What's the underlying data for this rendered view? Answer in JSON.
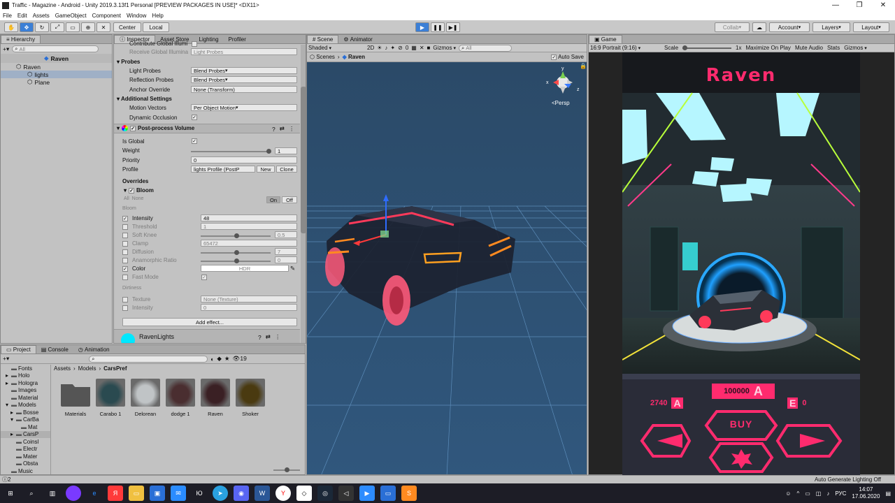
{
  "window": {
    "title": "Traffic - Magazine - Android - Unity 2019.3.13f1 Personal [PREVIEW PACKAGES IN USE]* <DX11>"
  },
  "menu": [
    "File",
    "Edit",
    "Assets",
    "GameObject",
    "Component",
    "Window",
    "Help"
  ],
  "toolbar": {
    "center": "Center",
    "local": "Local",
    "collab": "Collab",
    "account": "Account",
    "layers": "Layers",
    "layout": "Layout"
  },
  "hierarchy": {
    "tab": "Hierarchy",
    "search_placeholder": "All",
    "scene": "Raven",
    "items": [
      "Raven",
      "lights",
      "Plane"
    ]
  },
  "inspector": {
    "tabs": [
      "Inspector",
      "Asset Store",
      "Lighting",
      "Profiler"
    ],
    "rows_top": [
      {
        "label": "Contribute Global Illumi",
        "value": ""
      },
      {
        "label": "Receive Global Illumina",
        "value": "Light Probes"
      }
    ],
    "probes": {
      "header": "Probes",
      "light_probes_label": "Light Probes",
      "light_probes": "Blend Probes",
      "reflection_probes_label": "Reflection Probes",
      "reflection_probes": "Blend Probes",
      "anchor_label": "Anchor Override",
      "anchor": "None (Transform)"
    },
    "additional": {
      "header": "Additional Settings",
      "motion_label": "Motion Vectors",
      "motion": "Per Object Motion",
      "occlusion_label": "Dynamic Occlusion"
    },
    "ppv": {
      "header": "Post-process Volume",
      "is_global": "Is Global",
      "weight_label": "Weight",
      "weight": "1",
      "priority_label": "Priority",
      "priority": "0",
      "profile_label": "Profile",
      "profile": "lights Profile (PostP",
      "new": "New",
      "clone": "Clone"
    },
    "overrides": {
      "header": "Overrides",
      "bloom": "Bloom",
      "all": "All",
      "none": "None",
      "on": "On",
      "off": "Off",
      "bloom_sub": "Bloom",
      "params": [
        {
          "label": "Intensity",
          "value": "48",
          "enabled": true
        },
        {
          "label": "Threshold",
          "value": "1",
          "enabled": false
        },
        {
          "label": "Soft Knee",
          "value": "0.5",
          "enabled": false
        },
        {
          "label": "Clamp",
          "value": "65472",
          "enabled": false
        },
        {
          "label": "Diffusion",
          "value": "7",
          "enabled": false
        },
        {
          "label": "Anamorphic Ratio",
          "value": "0",
          "enabled": false
        },
        {
          "label": "Color",
          "value": "HDR",
          "enabled": true
        },
        {
          "label": "Fast Mode",
          "value": "",
          "enabled": false
        }
      ],
      "dirtiness": "Dirtiness",
      "texture_label": "Texture",
      "texture": "None (Texture)",
      "dirt_intensity_label": "Intensity",
      "dirt_intensity": "0",
      "add_effect": "Add effect...",
      "raven_lights": "RavenLights"
    }
  },
  "scene": {
    "tabs": [
      "Scene",
      "Animator"
    ],
    "shaded": "Shaded",
    "mode2d": "2D",
    "gizmos": "Gizmos",
    "search_placeholder": "All",
    "breadcrumb_scenes": "Scenes",
    "breadcrumb_current": "Raven",
    "autosave": "Auto Save",
    "persp": "Persp",
    "axis_x": "x",
    "axis_y": "y",
    "axis_z": "z",
    "counter": "0"
  },
  "game": {
    "tab": "Game",
    "aspect": "16:9 Portrait (9:16)",
    "scale_label": "Scale",
    "scale_value": "1x",
    "maximize": "Maximize On Play",
    "mute": "Mute Audio",
    "stats": "Stats",
    "gizmos": "Gizmos",
    "car_name": "Raven",
    "price": "100000",
    "currency": "A",
    "coins": "2740",
    "gems": "0",
    "buy": "BUY",
    "accent": "#ff2b6e"
  },
  "project": {
    "tabs": [
      "Project",
      "Console",
      "Animation"
    ],
    "count": "19",
    "breadcrumb": [
      "Assets",
      "Models",
      "CarsPref"
    ],
    "tree": [
      "Fonts",
      "Holo",
      "Hologra",
      "Images",
      "Material",
      "Models",
      "Bosse",
      "CarBa",
      "Mat",
      "CarsP",
      "Coinsl",
      "Electr",
      "Mater",
      "Obsta",
      "Music"
    ],
    "assets": [
      "Materials",
      "Carabo 1",
      "Delorean",
      "dodge 1",
      "Raven",
      "Shoker"
    ]
  },
  "status": {
    "lighting": "Auto Generate Lighting Off",
    "errors": "2"
  },
  "taskbar": {
    "time": "14:07",
    "date": "17.06.2020",
    "lang": "РУС"
  }
}
